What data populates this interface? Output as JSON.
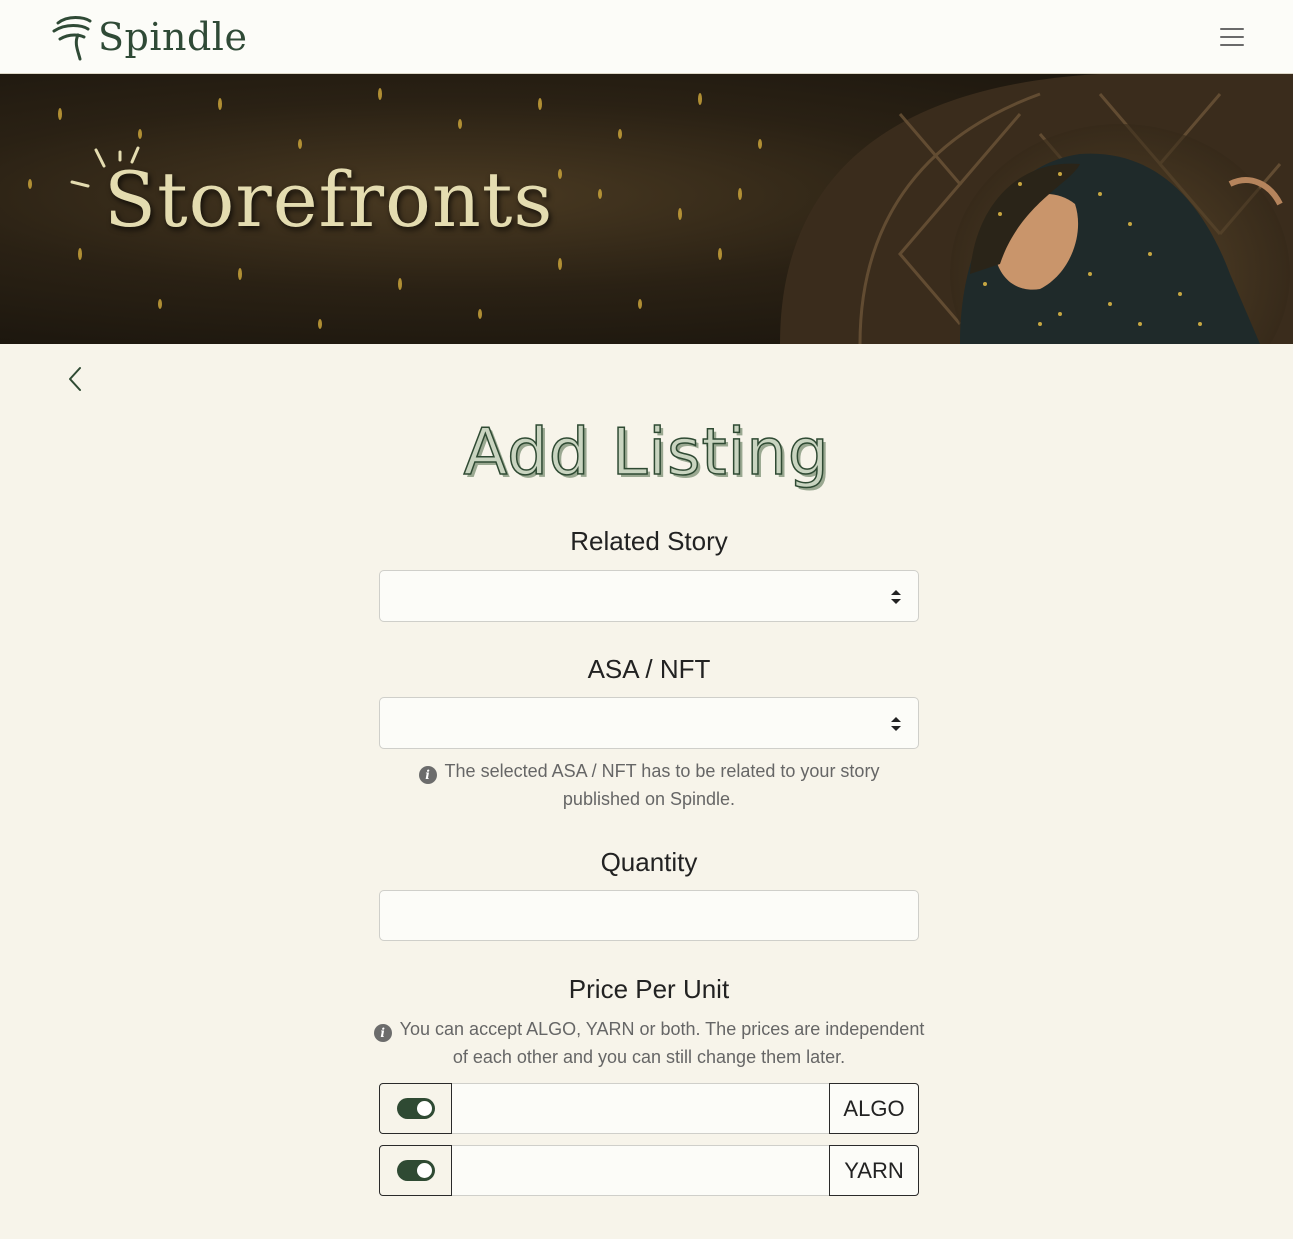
{
  "header": {
    "logo_text": "Spindle",
    "menu_icon": "hamburger-icon"
  },
  "banner": {
    "title": "Storefronts"
  },
  "navigation": {
    "back_icon": "chevron-left-icon"
  },
  "form": {
    "title": "Add Listing",
    "related_story": {
      "label": "Related Story",
      "value": ""
    },
    "asa_nft": {
      "label": "ASA / NFT",
      "value": "",
      "hint": "The selected ASA / NFT has to be related to your story published on Spindle."
    },
    "quantity": {
      "label": "Quantity",
      "value": ""
    },
    "price_per_unit": {
      "label": "Price Per Unit",
      "hint": "You can accept ALGO, YARN or both. The prices are independent of each other and you can still change them later.",
      "rows": [
        {
          "currency": "ALGO",
          "enabled": true,
          "value": ""
        },
        {
          "currency": "YARN",
          "enabled": true,
          "value": ""
        }
      ]
    }
  },
  "colors": {
    "brand_green": "#2f4a33",
    "page_background": "#f7f4ea",
    "banner_text": "#e4dcb0"
  }
}
